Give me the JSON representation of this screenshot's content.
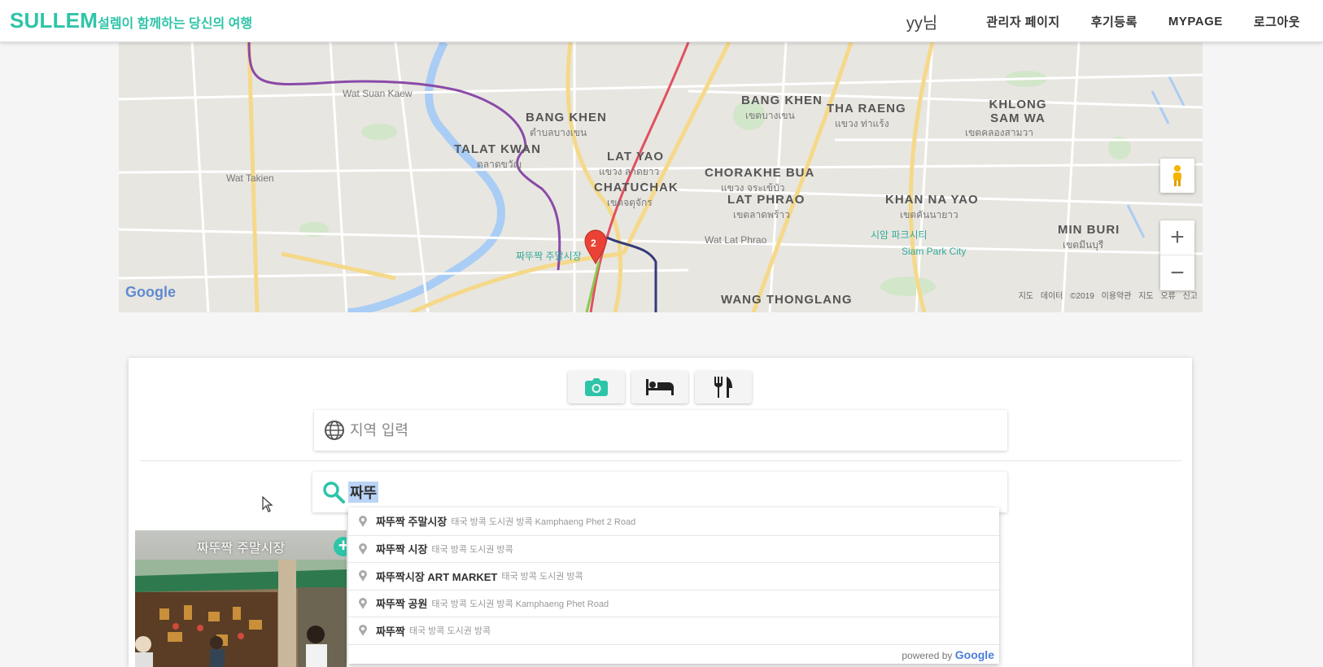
{
  "header": {
    "brand": "SULLEM",
    "tagline": "설렘이 함께하는 당신의 여행",
    "user": "yy님",
    "nav": [
      "관리자 페이지",
      "후기등록",
      "MYPAGE",
      "로그아웃"
    ]
  },
  "map": {
    "districts": [
      {
        "name": "BANG KHEN",
        "thai": "ตำบลบางเขน"
      },
      {
        "name": "TALAT KWAN",
        "thai": "ตลาดขวัญ"
      },
      {
        "name": "LAT YAO",
        "thai": "แขวง ลาดยาว"
      },
      {
        "name": "CHATUCHAK",
        "thai": "เขตจตุจักร"
      },
      {
        "name": "BANG KHEN",
        "thai": "เขตบางเขน"
      },
      {
        "name": "THA RAENG",
        "thai": "แขวง ท่าแร้ง"
      },
      {
        "name": "KHLONG SAM WA",
        "thai": "เขตคลองสามวา"
      },
      {
        "name": "CHORAKHE BUA",
        "thai": "แขวง จระเข้บัว"
      },
      {
        "name": "LAT PHRAO",
        "thai": "เขตลาดพร้าว"
      },
      {
        "name": "KHAN NA YAO",
        "thai": "เขตคันนายาว"
      },
      {
        "name": "MIN BURI",
        "thai": "เขตมีนบุรี"
      },
      {
        "name": "WANG THONGLANG",
        "thai": ""
      }
    ],
    "pois": [
      "Wat Suan Kaew",
      "Wat Takien",
      "Wat Lat Phrao",
      "시암 파크시티",
      "Siam Park City",
      "짜뚜짝 주말시장"
    ],
    "marker_count": "2",
    "attribution": [
      "지도 데이터 ©2019",
      "이용약관",
      "지도 오류 신고"
    ],
    "google": "Google",
    "zoom_in": "+",
    "zoom_out": "−"
  },
  "panel": {
    "categories": [
      "camera-icon",
      "bed-icon",
      "restaurant-icon"
    ],
    "region_placeholder": "지역 입력",
    "search_value": "짜뚜",
    "thumbnail_caption": "짜뚜짝 주말시장",
    "thumbnail_add": "+"
  },
  "autocomplete": {
    "items": [
      {
        "main": "짜뚜짝 주말시장",
        "secondary": "태국 방콕 도시권 방콕 Kamphaeng Phet 2 Road"
      },
      {
        "main": "짜뚜짝 시장",
        "secondary": "태국 방콕 도시권 방콕"
      },
      {
        "main": "짜뚜짝시장 ART MARKET",
        "secondary": "태국 방콕 도시권 방콕"
      },
      {
        "main": "짜뚜짝 공원",
        "secondary": "태국 방콕 도시권 방콕 Kamphaeng Phet Road"
      },
      {
        "main": "짜뚜짝",
        "secondary": "태국 방콕 도시권 방콕"
      }
    ],
    "powered_by": "powered by",
    "powered_brand": "Google"
  },
  "colors": {
    "brand": "#2ec4a8",
    "marker": "#ea4335",
    "selection": "#b9d4f5"
  }
}
